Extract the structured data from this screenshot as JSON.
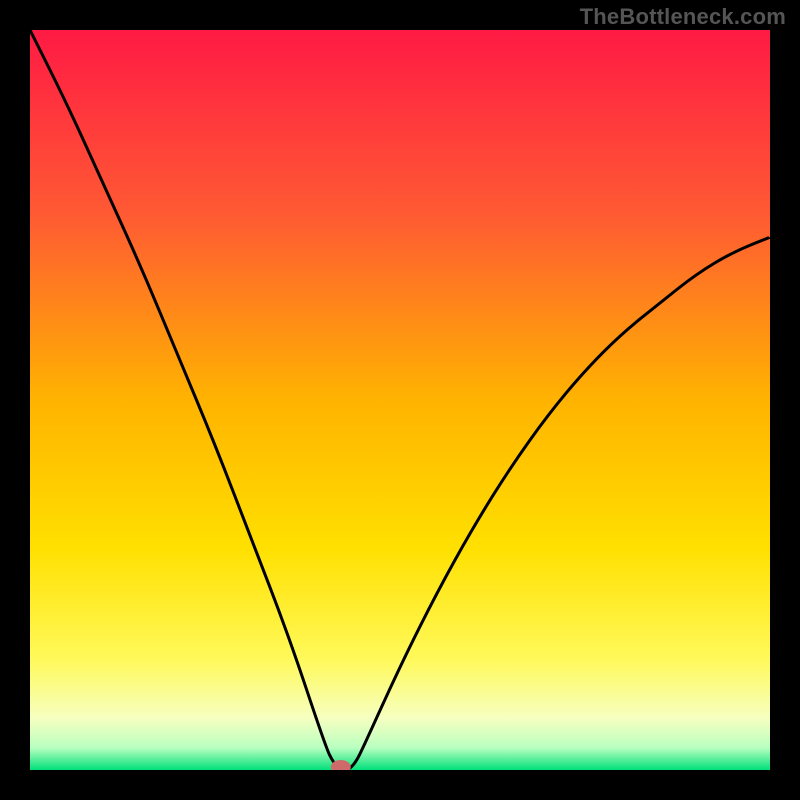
{
  "watermark": "TheBottleneck.com",
  "chart_data": {
    "type": "line",
    "title": "",
    "xlabel": "",
    "ylabel": "",
    "xlim": [
      0,
      100
    ],
    "ylim": [
      0,
      100
    ],
    "grid": false,
    "legend": "none",
    "series": [
      {
        "name": "bottleneck-curve",
        "x": [
          0,
          5,
          10,
          15,
          20,
          25,
          30,
          35,
          40,
          41,
          42,
          43,
          44,
          45,
          50,
          55,
          60,
          65,
          70,
          75,
          80,
          85,
          90,
          95,
          100
        ],
        "values": [
          100,
          90,
          79,
          68,
          56,
          44,
          31,
          18,
          3,
          1,
          0,
          0,
          1,
          3,
          14,
          24,
          33,
          41,
          48,
          54,
          59,
          63,
          67,
          70,
          72
        ]
      }
    ],
    "marker": {
      "x": 42,
      "y": 0
    },
    "background_gradient": {
      "stops": [
        {
          "offset": 0.0,
          "color": "#ff1a44"
        },
        {
          "offset": 0.25,
          "color": "#ff5a33"
        },
        {
          "offset": 0.5,
          "color": "#ffb300"
        },
        {
          "offset": 0.7,
          "color": "#ffe000"
        },
        {
          "offset": 0.85,
          "color": "#fff95a"
        },
        {
          "offset": 0.93,
          "color": "#f6ffc0"
        },
        {
          "offset": 0.97,
          "color": "#b8ffc0"
        },
        {
          "offset": 1.0,
          "color": "#00e07a"
        }
      ]
    },
    "curve_stroke": "#000000",
    "marker_color": "#cf6a6a"
  }
}
